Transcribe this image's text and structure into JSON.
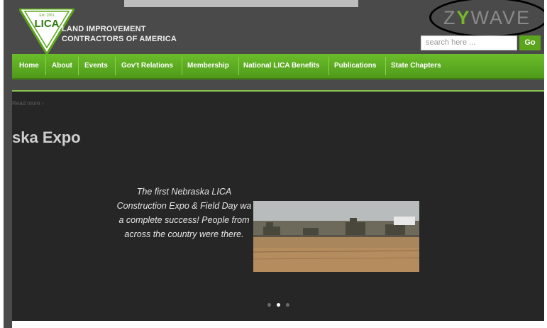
{
  "logo": {
    "text": "LICA",
    "small_text": "Est. 1951"
  },
  "org": {
    "line1": "LAND IMPROVEMENT",
    "line2": "CONTRACTORS OF AMERICA"
  },
  "watermark": {
    "text_left": "Z",
    "text_mid": "Y",
    "text_right": "WAVE",
    "accent_color": "#76b82a"
  },
  "search": {
    "placeholder": "search here ...",
    "go_label": "Go"
  },
  "nav": {
    "items": [
      "Home",
      "About",
      "Events",
      "Gov't Relations",
      "Membership",
      "National LICA Benefits",
      "Publications",
      "State Chapters"
    ]
  },
  "slide": {
    "read_more": "Read more ›",
    "title": "ska Expo",
    "caption_lines": [
      "The first Nebraska LICA",
      "Construction Expo & Field Day wa",
      "a complete success! People from",
      "across the country were there."
    ],
    "dots_active": 2,
    "dots_total": 3
  },
  "colors": {
    "nav_green": "#5aa51b",
    "background": "#4a4a4a",
    "slider_bg": "#262626"
  }
}
